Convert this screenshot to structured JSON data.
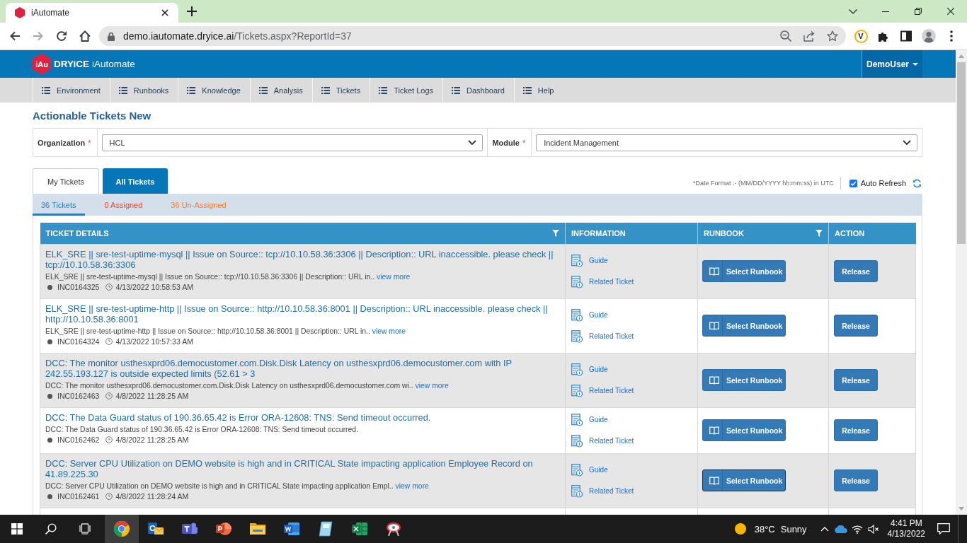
{
  "browser": {
    "tab_title": "iAutomate",
    "url_host": "demo.iautomate.dryice.ai",
    "url_path": "/Tickets.aspx?ReportId=37",
    "extension_letter": "V",
    "nav_buttons": [
      {
        "kind": "back",
        "disabled": false
      },
      {
        "kind": "forward",
        "disabled": true
      },
      {
        "kind": "reload",
        "disabled": false
      },
      {
        "kind": "home",
        "disabled": false
      }
    ]
  },
  "header": {
    "logo_badge": "iAu",
    "brand": "DRYiCE",
    "product": "iAutomate",
    "user_menu": "DemoUser"
  },
  "nav": [
    "Environment",
    "Runbooks",
    "Knowledge",
    "Analysis",
    "Tickets",
    "Ticket Logs",
    "Dashboard",
    "Help"
  ],
  "page_title": "Actionable Tickets New",
  "filters": [
    {
      "label": "Organization",
      "required_mark": "*",
      "value": "HCL"
    },
    {
      "label": "Module",
      "required_mark": "*",
      "value": "Incident Management"
    }
  ],
  "tabs": [
    {
      "label": "My Tickets",
      "selected": false
    },
    {
      "label": "All Tickets",
      "selected": true
    }
  ],
  "date_format_note": "*Date Format :- (MM/DD/YYYY hh:mm:ss) in UTC",
  "auto_refresh": {
    "label": "Auto Refresh",
    "checked": true
  },
  "counts": [
    {
      "label": "36 Tickets",
      "selected": true,
      "color": "#337ab7"
    },
    {
      "label": "0 Assigned",
      "selected": false,
      "color": "#e4472f"
    },
    {
      "label": "36 Un-Assigned",
      "selected": false,
      "color": "#f47d2e"
    }
  ],
  "table": {
    "columns": [
      {
        "label": "TICKET DETAILS",
        "filter": true
      },
      {
        "label": "INFORMATION",
        "filter": false
      },
      {
        "label": "RUNBOOK",
        "filter": true
      },
      {
        "label": "ACTION",
        "filter": false
      }
    ],
    "rows": [
      {
        "title": "ELK_SRE || sre-test-uptime-mysql || Issue on Source:: tcp://10.10.58.36:3306 || Description:: URL inaccessible. please check || tcp://10.10.58.36:3306",
        "summary": "ELK_SRE || sre-test-uptime-mysql || Issue on Source:: tcp://10.10.58.36:3306 || Description:: URL in..",
        "view_more": "view more",
        "ticket_id": "INC0164325",
        "time": "4/13/2022 10:58:53 AM",
        "links": [
          "Guide",
          "Related Ticket"
        ],
        "runbook_button": "Select Runbook",
        "action_button": "Release",
        "runbook_focused": false
      },
      {
        "title": "ELK_SRE || sre-test-uptime-http || Issue on Source:: http://10.10.58.36:8001 || Description:: URL inaccessible. please check || http://10.10.58.36:8001",
        "summary": "ELK_SRE || sre-test-uptime-http || Issue on Source:: http://10.10.58.36:8001 || Description:: URL in..",
        "view_more": "view more",
        "ticket_id": "INC0164324",
        "time": "4/13/2022 10:57:33 AM",
        "links": [
          "Guide",
          "Related Ticket"
        ],
        "runbook_button": "Select Runbook",
        "action_button": "Release",
        "runbook_focused": false
      },
      {
        "title": "DCC: The monitor usthesxprd06.democustomer.com.Disk.Disk Latency on usthesxprd06.democustomer.com with IP 242.55.193.127 is outside expected limits (52.61 > 3",
        "summary": "DCC: The monitor usthesxprd06.democustomer.com.Disk.Disk Latency on usthesxprd06.democustomer.com wi..",
        "view_more": "view more",
        "ticket_id": "INC0162463",
        "time": "4/8/2022 11:28:25 AM",
        "links": [
          "Guide",
          "Related Ticket"
        ],
        "runbook_button": "Select Runbook",
        "action_button": "Release",
        "runbook_focused": false
      },
      {
        "title": "DCC: The Data Guard status of 190.36.65.42 is Error ORA-12608: TNS: Send timeout occurred.",
        "summary": "DCC: The Data Guard status of 190.36.65.42 is Error ORA-12608: TNS: Send timeout occurred.",
        "ticket_id": "INC0162462",
        "time": "4/8/2022 11:28:25 AM",
        "links": [
          "Guide",
          "Related Ticket"
        ],
        "runbook_button": "Select Runbook",
        "action_button": "Release",
        "runbook_focused": false
      },
      {
        "title": "DCC: Server CPU Utilization on DEMO website is high and in CRITICAL State impacting application Employee Record on 41.89.225.30",
        "summary": "DCC: Server CPU Utilization on DEMO website is high and in CRITICAL State impacting application Empl..",
        "view_more": "view more",
        "ticket_id": "INC0162461",
        "time": "4/8/2022 11:28:24 AM",
        "links": [
          "Guide",
          "Related Ticket"
        ],
        "runbook_button": "Select Runbook",
        "action_button": "Release",
        "runbook_focused": true
      }
    ]
  },
  "taskbar": {
    "apps": [
      {
        "kind": "browser",
        "active": true
      },
      {
        "kind": "mail",
        "active": false
      },
      {
        "kind": "chat",
        "active": false
      },
      {
        "kind": "presentation",
        "active": false
      },
      {
        "kind": "files",
        "active": false
      },
      {
        "kind": "document",
        "active": false
      },
      {
        "kind": "notes",
        "active": false
      },
      {
        "kind": "spreadsheet",
        "active": false
      },
      {
        "kind": "snip",
        "active": false
      }
    ],
    "weather": {
      "temperature": "38°C",
      "condition": "Sunny"
    },
    "clock": {
      "time": "4:41 PM",
      "date": "4/13/2022"
    }
  }
}
